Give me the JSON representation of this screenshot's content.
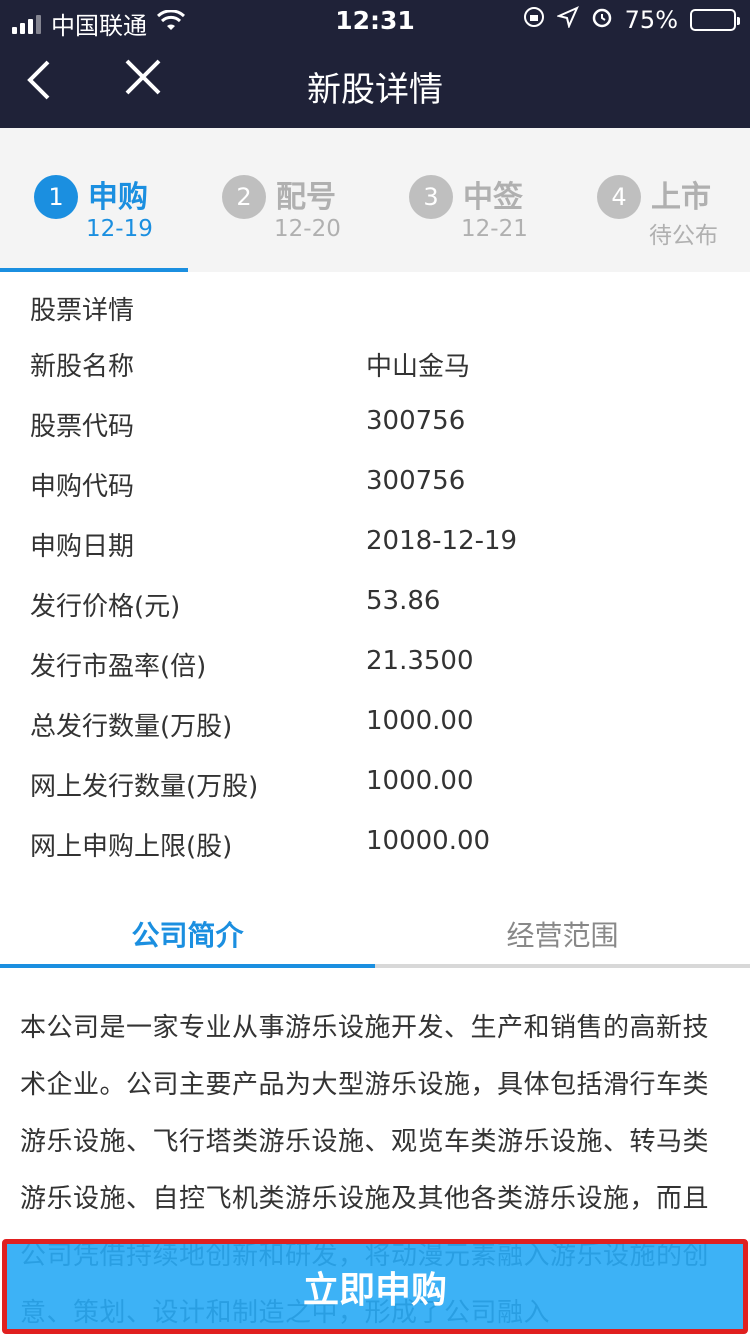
{
  "status_bar": {
    "carrier": "中国联通",
    "time": "12:31",
    "battery_percent": "75%",
    "battery_level": 0.75
  },
  "nav": {
    "title": "新股详情",
    "back_icon": "chevron-left-icon",
    "close_icon": "close-icon"
  },
  "steps": [
    {
      "num": "1",
      "name": "申购",
      "date": "12-19",
      "active": true
    },
    {
      "num": "2",
      "name": "配号",
      "date": "12-20",
      "active": false
    },
    {
      "num": "3",
      "name": "中签",
      "date": "12-21",
      "active": false
    },
    {
      "num": "4",
      "name": "上市",
      "date": "待公布",
      "active": false
    }
  ],
  "details": {
    "section_title": "股票详情",
    "rows": [
      {
        "label": "新股名称",
        "value": "中山金马"
      },
      {
        "label": "股票代码",
        "value": "300756"
      },
      {
        "label": "申购代码",
        "value": "300756"
      },
      {
        "label": "申购日期",
        "value": "2018-12-19"
      },
      {
        "label": "发行价格(元)",
        "value": "53.86"
      },
      {
        "label": "发行市盈率(倍)",
        "value": "21.3500"
      },
      {
        "label": "总发行数量(万股)",
        "value": "1000.00"
      },
      {
        "label": "网上发行数量(万股)",
        "value": "1000.00"
      },
      {
        "label": "网上申购上限(股)",
        "value": "10000.00"
      }
    ]
  },
  "tabs": [
    {
      "label": "公司简介",
      "active": true
    },
    {
      "label": "经营范围",
      "active": false
    }
  ],
  "intro_text": "本公司是一家专业从事游乐设施开发、生产和销售的高新技术企业。公司主要产品为大型游乐设施，具体包括滑行车类游乐设施、飞行塔类游乐设施、观览车类游乐设施、转马类游乐设施、自控飞机类游乐设施及其他各类游乐设施，而且公司凭借持续地创新和研发，将动漫元素融入游乐设施的创意、策划、设计和制造之中，形成了公司融入",
  "cta": {
    "label": "立即申购"
  },
  "colors": {
    "accent": "#1b8fe0",
    "header_bg": "#1f2238",
    "highlight_border": "#e02020"
  }
}
